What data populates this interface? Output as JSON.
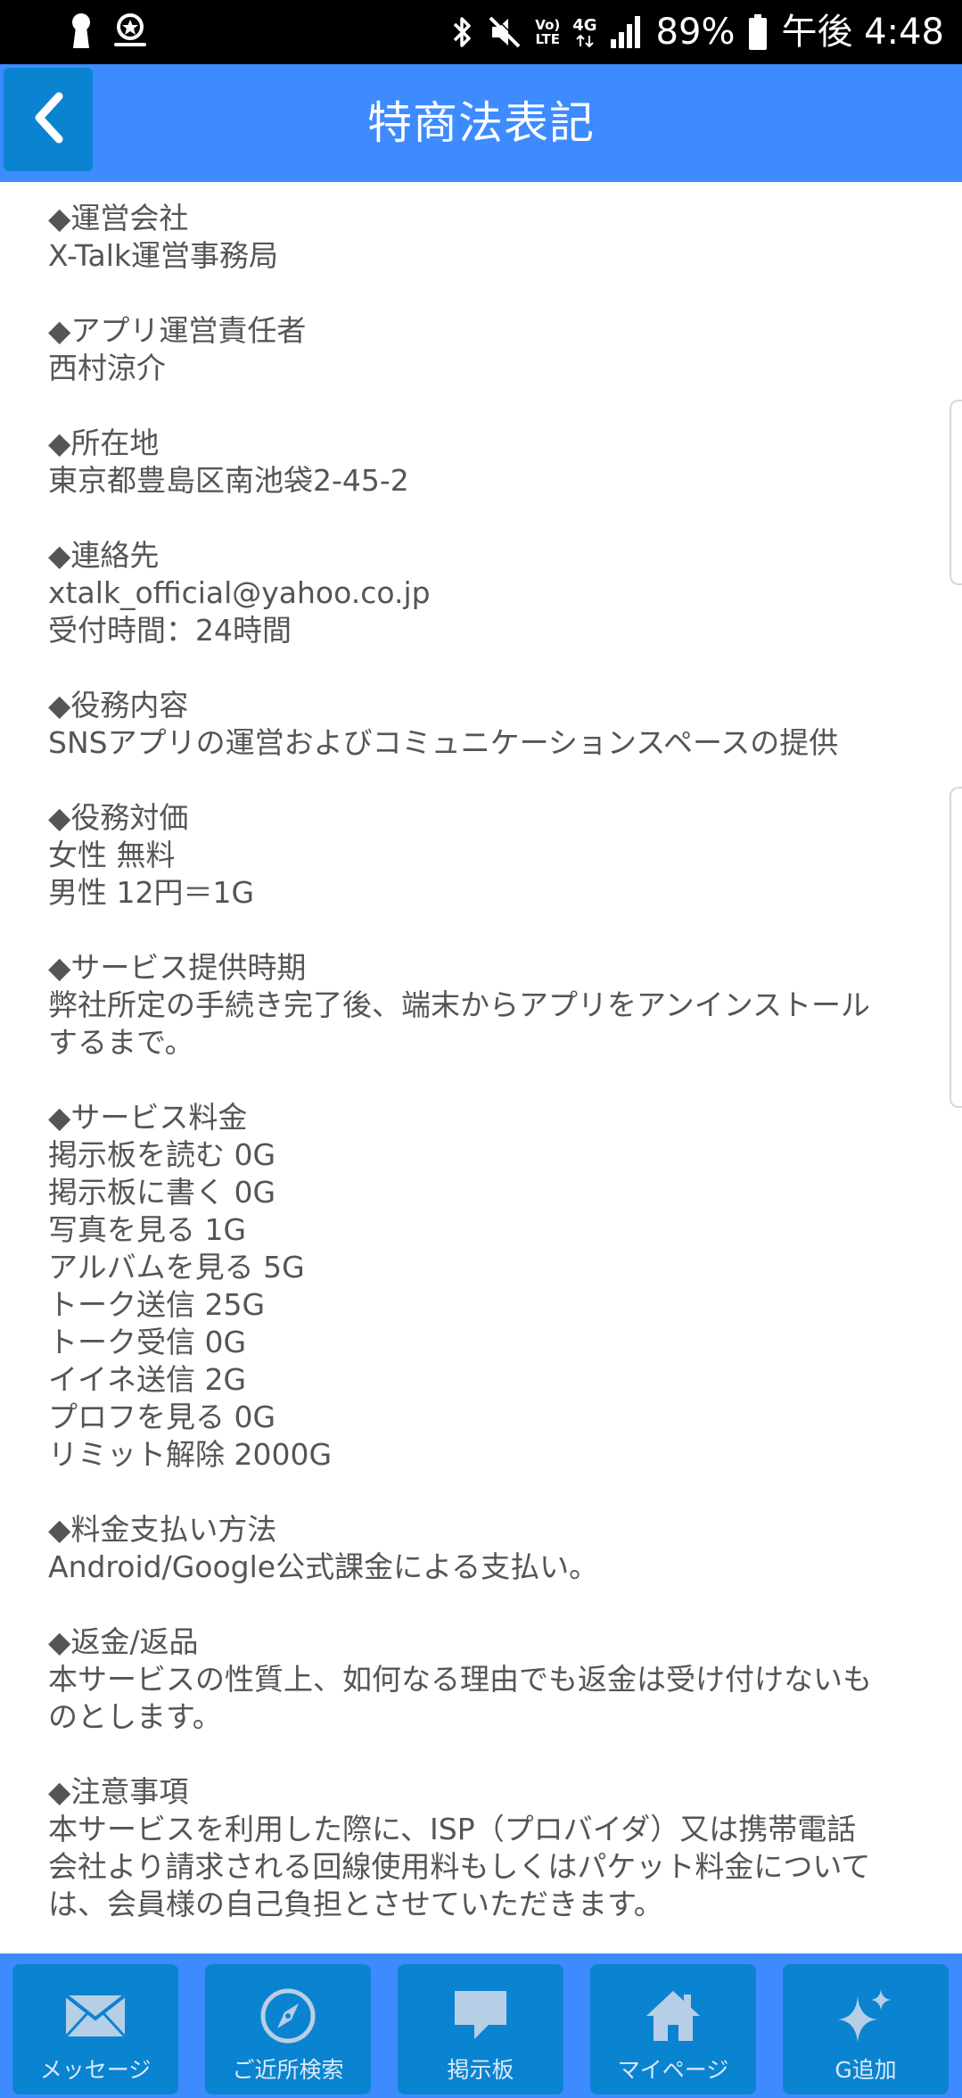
{
  "status_bar": {
    "icons": [
      "keyhole-icon",
      "location-badge-icon",
      "bluetooth-icon",
      "mute-icon",
      "volte-icon",
      "4g-icon",
      "signal-icon",
      "battery-icon"
    ],
    "volte_top": "Vo)",
    "volte_bottom": "LTE",
    "network": "4G",
    "battery": "89%",
    "time": "午後 4:48"
  },
  "header": {
    "title": "特商法表記",
    "back_icon": "chevron-left-icon"
  },
  "sections": [
    {
      "heading": "◆運営会社",
      "lines": [
        "X-Talk運営事務局"
      ]
    },
    {
      "heading": "◆アプリ運営責任者",
      "lines": [
        "西村涼介"
      ]
    },
    {
      "heading": "◆所在地",
      "lines": [
        "東京都豊島区南池袋2-45-2"
      ]
    },
    {
      "heading": "◆連絡先",
      "lines": [
        "xtalk_official@yahoo.co.jp",
        "受付時間：24時間"
      ]
    },
    {
      "heading": "◆役務内容",
      "lines": [
        "SNSアプリの運営およびコミュニケーションスペースの提供"
      ]
    },
    {
      "heading": "◆役務対価",
      "lines": [
        "女性 無料",
        "男性 12円＝1G"
      ]
    },
    {
      "heading": "◆サービス提供時期",
      "lines": [
        "弊社所定の手続き完了後、端末からアプリをアンインストール",
        "するまで。"
      ]
    },
    {
      "heading": "◆サービス料金",
      "lines": [
        "掲示板を読む 0G",
        "掲示板に書く 0G",
        "写真を見る 1G",
        "アルバムを見る 5G",
        "トーク送信 25G",
        "トーク受信 0G",
        "イイネ送信 2G",
        "プロフを見る 0G",
        "リミット解除 2000G"
      ]
    },
    {
      "heading": "◆料金支払い方法",
      "lines": [
        "Android/Google公式課金による支払い。"
      ]
    },
    {
      "heading": "◆返金/返品",
      "lines": [
        "本サービスの性質上、如何なる理由でも返金は受け付けないも",
        "のとします。"
      ]
    },
    {
      "heading": "◆注意事項",
      "lines": [
        "本サービスを利用した際に、ISP（プロバイダ）又は携帯電話",
        "会社より請求される回線使用料もしくはパケット料金について",
        "は、会員様の自己負担とさせていただきます。"
      ]
    }
  ],
  "nav": [
    {
      "label": "メッセージ",
      "icon": "envelope-icon"
    },
    {
      "label": "ご近所検索",
      "icon": "compass-icon"
    },
    {
      "label": "掲示板",
      "icon": "speech-bubble-icon"
    },
    {
      "label": "マイページ",
      "icon": "home-icon"
    },
    {
      "label": "G追加",
      "icon": "sparkle-icon"
    }
  ],
  "colors": {
    "header_bg": "#3d8bff",
    "button_bg": "#0a84d0",
    "text": "#555555",
    "status_bar_bg": "#000000"
  }
}
